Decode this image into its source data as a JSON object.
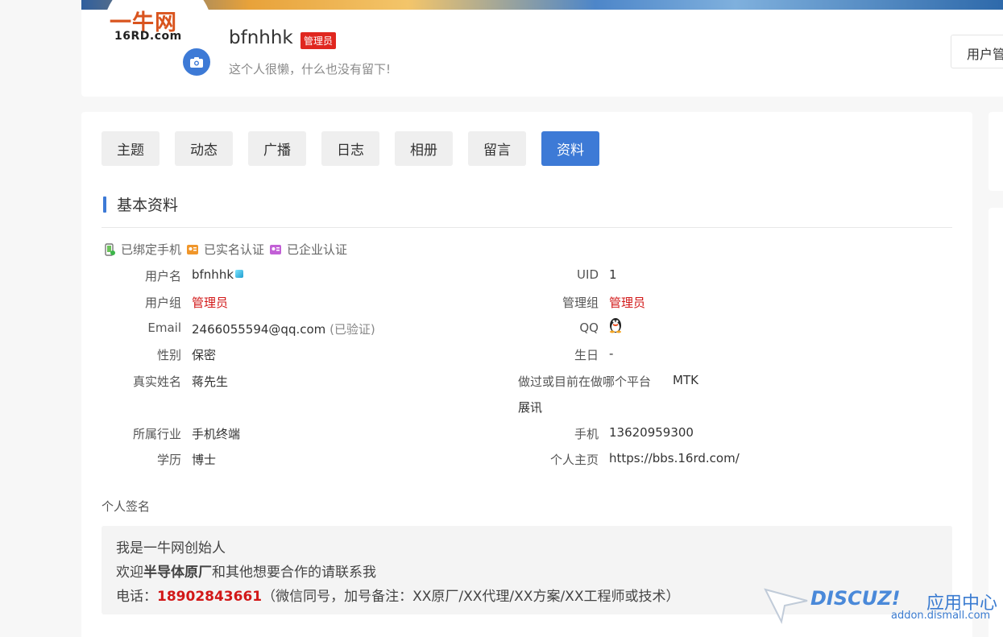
{
  "profile": {
    "logo_main": "一牛网",
    "logo_sub": "16RD.com",
    "username": "bfnhhk",
    "badge": "管理员",
    "motto": "这个人很懒，什么也没有留下!",
    "user_mgmt_label": "用户管"
  },
  "tabs": [
    "主题",
    "动态",
    "广播",
    "日志",
    "相册",
    "留言",
    "资料"
  ],
  "active_tab": "资料",
  "section": {
    "title": "基本资料"
  },
  "verify": {
    "phone": "已绑定手机",
    "realname": "已实名认证",
    "enterprise": "已企业认证"
  },
  "fields": {
    "username_label": "用户名",
    "username_value": "bfnhhk",
    "uid_label": "UID",
    "uid_value": "1",
    "group_label": "用户组",
    "group_value": "管理员",
    "admin_group_label": "管理组",
    "admin_group_value": "管理员",
    "email_label": "Email",
    "email_value": "2466055594@qq.com",
    "email_status": "(已验证)",
    "qq_label": "QQ",
    "gender_label": "性别",
    "gender_value": "保密",
    "birthday_label": "生日",
    "birthday_value": "-",
    "realname_label": "真实姓名",
    "realname_value": "蒋先生",
    "platform_label": "做过或目前在做哪个平台",
    "platform_value": "MTK",
    "platform_value2": "展讯",
    "industry_label": "所属行业",
    "industry_value": "手机终端",
    "mobile_label": "手机",
    "mobile_value": "13620959300",
    "education_label": "学历",
    "education_value": "博士",
    "homepage_label": "个人主页",
    "homepage_value": "https://bbs.16rd.com/"
  },
  "signature": {
    "label": "个人签名",
    "line1": "我是一牛网创始人",
    "line2_prefix": "欢迎",
    "line2_bold": "半导体原厂",
    "line2_suffix": "和其他想要合作的请联系我",
    "line3_prefix": "电话：",
    "line3_phone": "18902843661",
    "line3_suffix": "（微信同号，加号备注：XX原厂/XX代理/XX方案/XX工程师或技术）"
  },
  "watermark": {
    "brand": "DISCUZ!",
    "cn": "应用中心",
    "url": "addon.dismall.com"
  },
  "colors": {
    "accent": "#3d7ad6",
    "red": "#d21818",
    "badge": "#e0271f"
  }
}
